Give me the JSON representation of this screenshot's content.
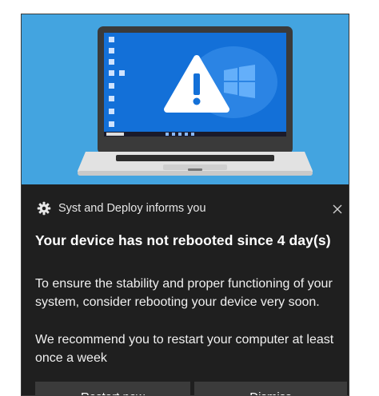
{
  "notification": {
    "app_name": "Syst and Deploy informs you",
    "title": "Your device has not rebooted since 4 day(s)",
    "message_1": "To ensure the stability and proper functioning of your system, consider rebooting your device very soon.",
    "message_2": "We recommend you to restart your computer at least once a week",
    "buttons": {
      "restart": "Restart now",
      "dismiss": "Dismiss"
    }
  },
  "icons": {
    "app_icon": "gear-icon",
    "close": "close-icon",
    "hero_warning": "warning-icon",
    "hero_os_logo": "windows-logo-icon"
  },
  "colors": {
    "hero_background": "#43a4e0",
    "toast_background": "#1f1f1f",
    "button_background": "#3b3b3b",
    "laptop_screen": "#1370d8"
  }
}
